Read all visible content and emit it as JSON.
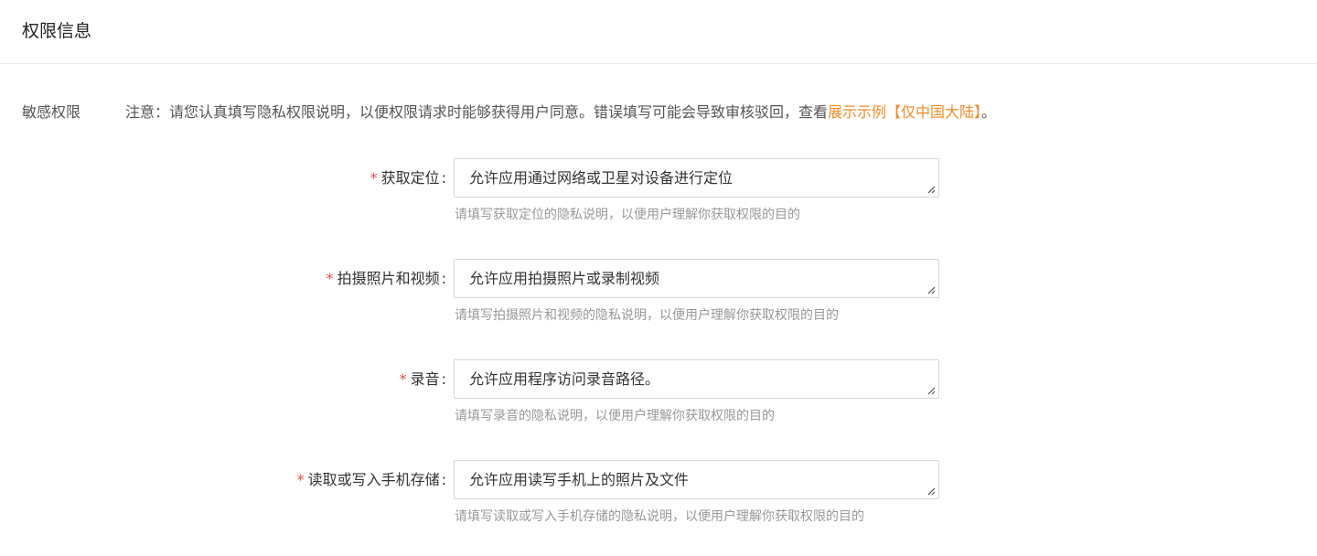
{
  "header": {
    "title": "权限信息"
  },
  "section": {
    "label": "敏感权限",
    "notice_text": "注意：请您认真填写隐私权限说明，以便权限请求时能够获得用户同意。错误填写可能会导致审核驳回，查看",
    "notice_link": "展示示例【仅中国大陆】",
    "notice_end": "。"
  },
  "fields": [
    {
      "required_mark": "*",
      "label": "获取定位",
      "colon": ":",
      "value": "允许应用通过网络或卫星对设备进行定位",
      "hint": "请填写获取定位的隐私说明，以便用户理解你获取权限的目的"
    },
    {
      "required_mark": "*",
      "label": "拍摄照片和视频",
      "colon": ":",
      "value": "允许应用拍摄照片或录制视频",
      "hint": "请填写拍摄照片和视频的隐私说明，以便用户理解你获取权限的目的"
    },
    {
      "required_mark": "*",
      "label": "录音",
      "colon": ":",
      "value": "允许应用程序访问录音路径。",
      "hint": "请填写录音的隐私说明，以便用户理解你获取权限的目的"
    },
    {
      "required_mark": "*",
      "label": "读取或写入手机存储",
      "colon": ":",
      "value": "允许应用读写手机上的照片及文件",
      "hint": "请填写读取或写入手机存储的隐私说明，以便用户理解你获取权限的目的"
    }
  ],
  "colors": {
    "required": "#f04a4a",
    "link": "#f38c24",
    "hint": "#999999"
  },
  "icons": {
    "textarea_corner": "resize-handle-icon"
  }
}
